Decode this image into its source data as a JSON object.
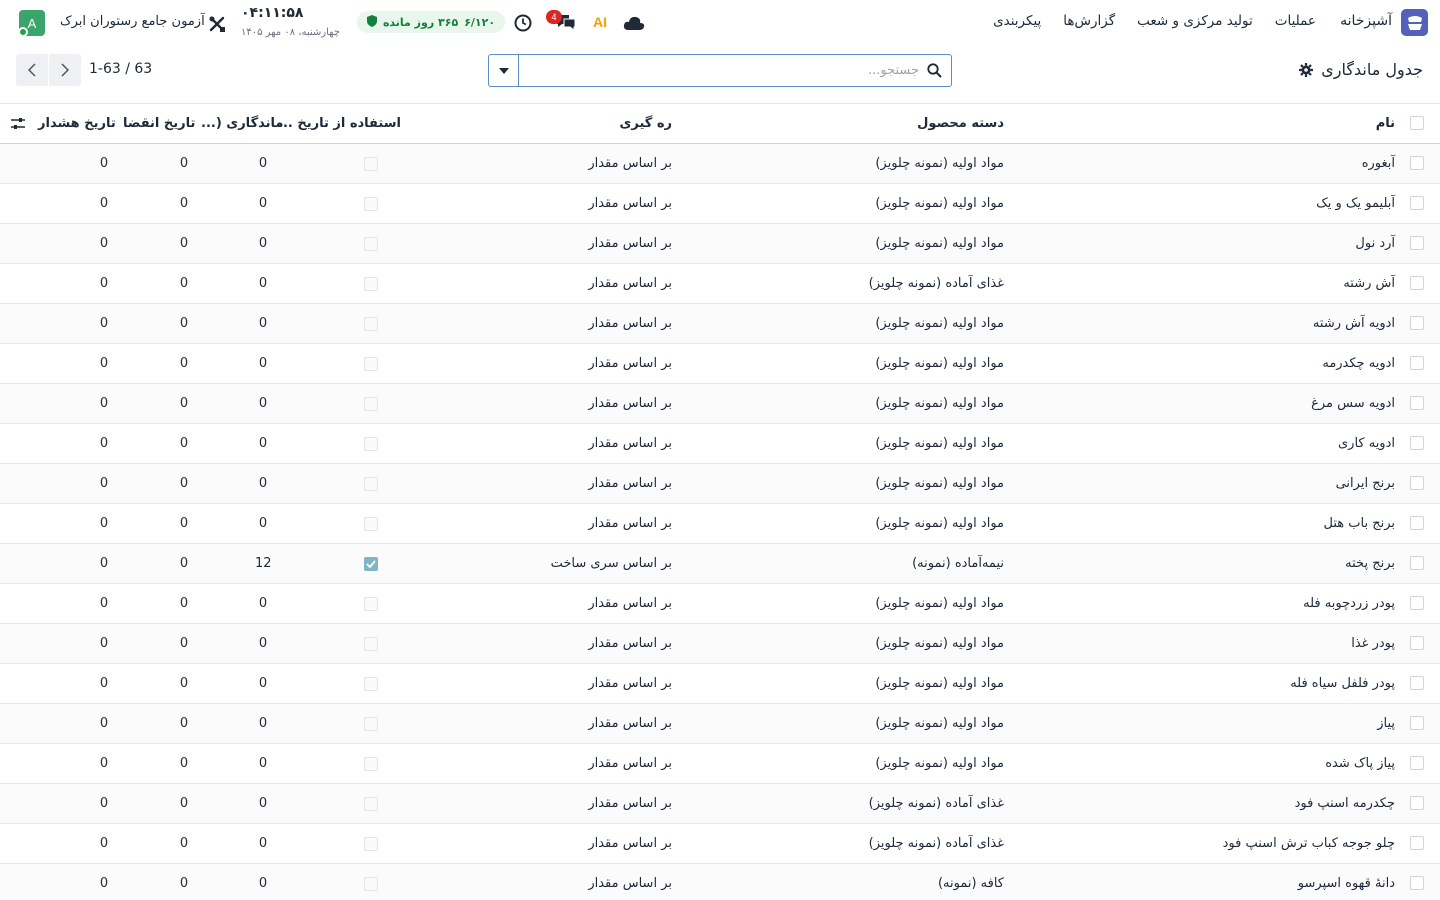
{
  "navbar": {
    "brand": "آشپزخانه",
    "menu": [
      "عملیات",
      "تولید مرکزی و شعب",
      "گزارش‌ها",
      "پیکربندی"
    ],
    "chat_badge": "4",
    "ai_label": "AI",
    "license_days": "۳۶۵ روز مانده",
    "license_total": "۶/۱۲۰",
    "clock_time": "۰۴:۱۱:۵۸",
    "clock_date": "چهارشنبه، ۰۸ مهر ۱۴۰۵",
    "company": "آزمون جامع رستوران ابرک",
    "avatar_letter": "A"
  },
  "control": {
    "title": "جدول ماندگاری",
    "search_placeholder": "جستجو...",
    "pager": "1-63 / 63"
  },
  "table": {
    "headers": {
      "name": "نام",
      "category": "دسته محصول",
      "method": "ره گیری",
      "use_expiry": "استفاده از تاریخ ...",
      "shelf_life": "ماندگاری (...",
      "expiry": "تاریخ انقضا",
      "alert": "تاریخ هشدار"
    },
    "rows": [
      {
        "name": "آبغوره",
        "category": "مواد اولیه (نمونه چلویز)",
        "method": "بر اساس مقدار",
        "use": false,
        "life": "0",
        "exp": "0",
        "alert": "0"
      },
      {
        "name": "آبلیمو یک و یک",
        "category": "مواد اولیه (نمونه چلویز)",
        "method": "بر اساس مقدار",
        "use": false,
        "life": "0",
        "exp": "0",
        "alert": "0"
      },
      {
        "name": "آرد نول",
        "category": "مواد اولیه (نمونه چلویز)",
        "method": "بر اساس مقدار",
        "use": false,
        "life": "0",
        "exp": "0",
        "alert": "0"
      },
      {
        "name": "آش رشته",
        "category": "غذای آماده (نمونه چلویز)",
        "method": "بر اساس مقدار",
        "use": false,
        "life": "0",
        "exp": "0",
        "alert": "0"
      },
      {
        "name": "ادویه آش رشته",
        "category": "مواد اولیه (نمونه چلویز)",
        "method": "بر اساس مقدار",
        "use": false,
        "life": "0",
        "exp": "0",
        "alert": "0"
      },
      {
        "name": "ادویه چکدرمه",
        "category": "مواد اولیه (نمونه چلویز)",
        "method": "بر اساس مقدار",
        "use": false,
        "life": "0",
        "exp": "0",
        "alert": "0"
      },
      {
        "name": "ادویه سس مرغ",
        "category": "مواد اولیه (نمونه چلویز)",
        "method": "بر اساس مقدار",
        "use": false,
        "life": "0",
        "exp": "0",
        "alert": "0"
      },
      {
        "name": "ادویه کاری",
        "category": "مواد اولیه (نمونه چلویز)",
        "method": "بر اساس مقدار",
        "use": false,
        "life": "0",
        "exp": "0",
        "alert": "0"
      },
      {
        "name": "برنج ایرانی",
        "category": "مواد اولیه (نمونه چلویز)",
        "method": "بر اساس مقدار",
        "use": false,
        "life": "0",
        "exp": "0",
        "alert": "0"
      },
      {
        "name": "برنج باب هتل",
        "category": "مواد اولیه (نمونه چلویز)",
        "method": "بر اساس مقدار",
        "use": false,
        "life": "0",
        "exp": "0",
        "alert": "0"
      },
      {
        "name": "برنج پخته",
        "category": "نیمه‌آماده (نمونه)",
        "method": "بر اساس سری ساخت",
        "use": true,
        "life": "12",
        "exp": "0",
        "alert": "0"
      },
      {
        "name": "پودر زردچوبه فله",
        "category": "مواد اولیه (نمونه چلویز)",
        "method": "بر اساس مقدار",
        "use": false,
        "life": "0",
        "exp": "0",
        "alert": "0"
      },
      {
        "name": "پودر غذا",
        "category": "مواد اولیه (نمونه چلویز)",
        "method": "بر اساس مقدار",
        "use": false,
        "life": "0",
        "exp": "0",
        "alert": "0"
      },
      {
        "name": "پودر فلفل سیاه فله",
        "category": "مواد اولیه (نمونه چلویز)",
        "method": "بر اساس مقدار",
        "use": false,
        "life": "0",
        "exp": "0",
        "alert": "0"
      },
      {
        "name": "پیاز",
        "category": "مواد اولیه (نمونه چلویز)",
        "method": "بر اساس مقدار",
        "use": false,
        "life": "0",
        "exp": "0",
        "alert": "0"
      },
      {
        "name": "پیاز پاک شده",
        "category": "مواد اولیه (نمونه چلویز)",
        "method": "بر اساس مقدار",
        "use": false,
        "life": "0",
        "exp": "0",
        "alert": "0"
      },
      {
        "name": "چکدرمه اسنپ فود",
        "category": "غذای آماده (نمونه چلویز)",
        "method": "بر اساس مقدار",
        "use": false,
        "life": "0",
        "exp": "0",
        "alert": "0"
      },
      {
        "name": "چلو جوجه کباب ترش اسنپ فود",
        "category": "غذای آماده (نمونه چلویز)",
        "method": "بر اساس مقدار",
        "use": false,
        "life": "0",
        "exp": "0",
        "alert": "0"
      },
      {
        "name": "دانهٔ قهوه اسپرسو",
        "category": "کافه (نمونه)",
        "method": "بر اساس مقدار",
        "use": false,
        "life": "0",
        "exp": "0",
        "alert": "0"
      }
    ]
  }
}
